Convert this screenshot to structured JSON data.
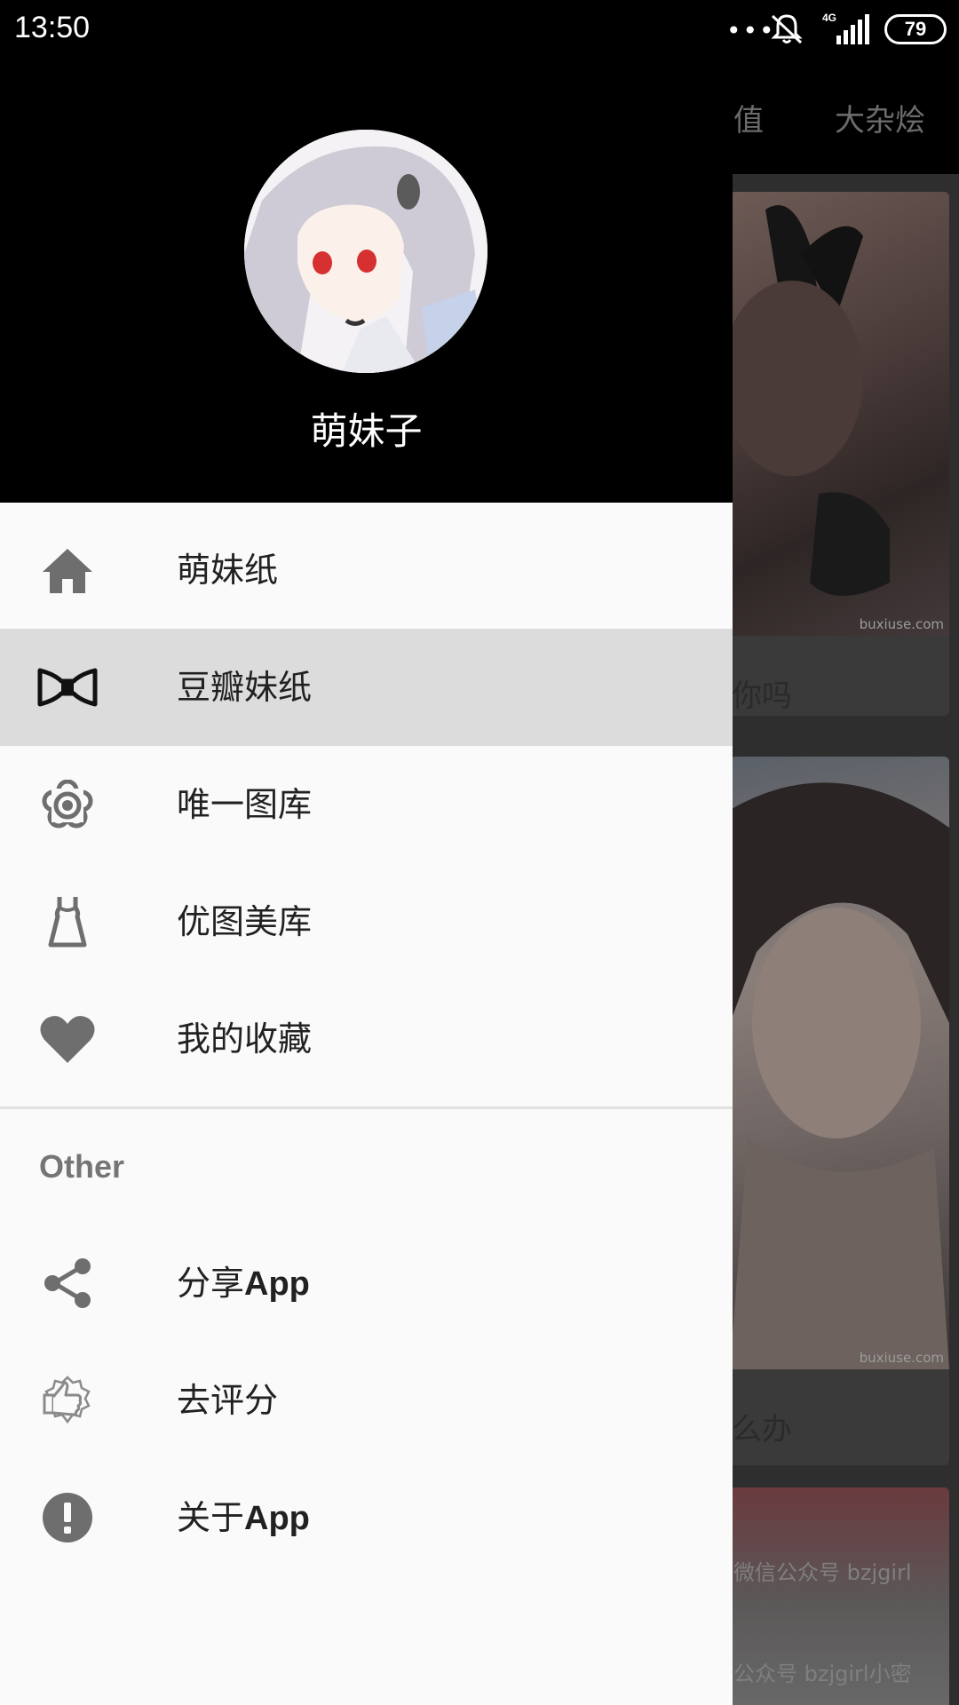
{
  "status_bar": {
    "time": "13:50",
    "signal_dots": "•••",
    "network_type": "4G",
    "battery": "79"
  },
  "background": {
    "tabs": [
      "值",
      "大杂烩"
    ],
    "cards": [
      {
        "caption": "你吗",
        "watermark": "buxiuse.com"
      },
      {
        "caption": "么办",
        "watermark": "buxiuse.com"
      },
      {
        "watermark_1": "微信公众号 bzjgirl",
        "watermark_2": "公众号 bzjgirl小密"
      }
    ]
  },
  "drawer": {
    "user_name": "萌妹子",
    "menu_items": [
      {
        "label": "萌妹纸",
        "icon": "home-icon",
        "active": false
      },
      {
        "label": "豆瓣妹纸",
        "icon": "bow-tie-icon",
        "active": true
      },
      {
        "label": "唯一图库",
        "icon": "flower-icon",
        "active": false
      },
      {
        "label": "优图美库",
        "icon": "dress-icon",
        "active": false
      },
      {
        "label": "我的收藏",
        "icon": "heart-icon",
        "active": false
      }
    ],
    "section_title": "Other",
    "other_items": [
      {
        "label_cn": "分享",
        "label_en": "App",
        "icon": "share-icon"
      },
      {
        "label_cn": "去评分",
        "label_en": "",
        "icon": "thumbs-up-badge-icon"
      },
      {
        "label_cn": "关于",
        "label_en": "App",
        "icon": "info-icon"
      }
    ]
  },
  "colors": {
    "header_bg": "#000000",
    "drawer_bg": "#fafafa",
    "active_bg": "#dcdcdc",
    "icon_gray": "#6e6e6e",
    "text_dark": "#212121"
  }
}
